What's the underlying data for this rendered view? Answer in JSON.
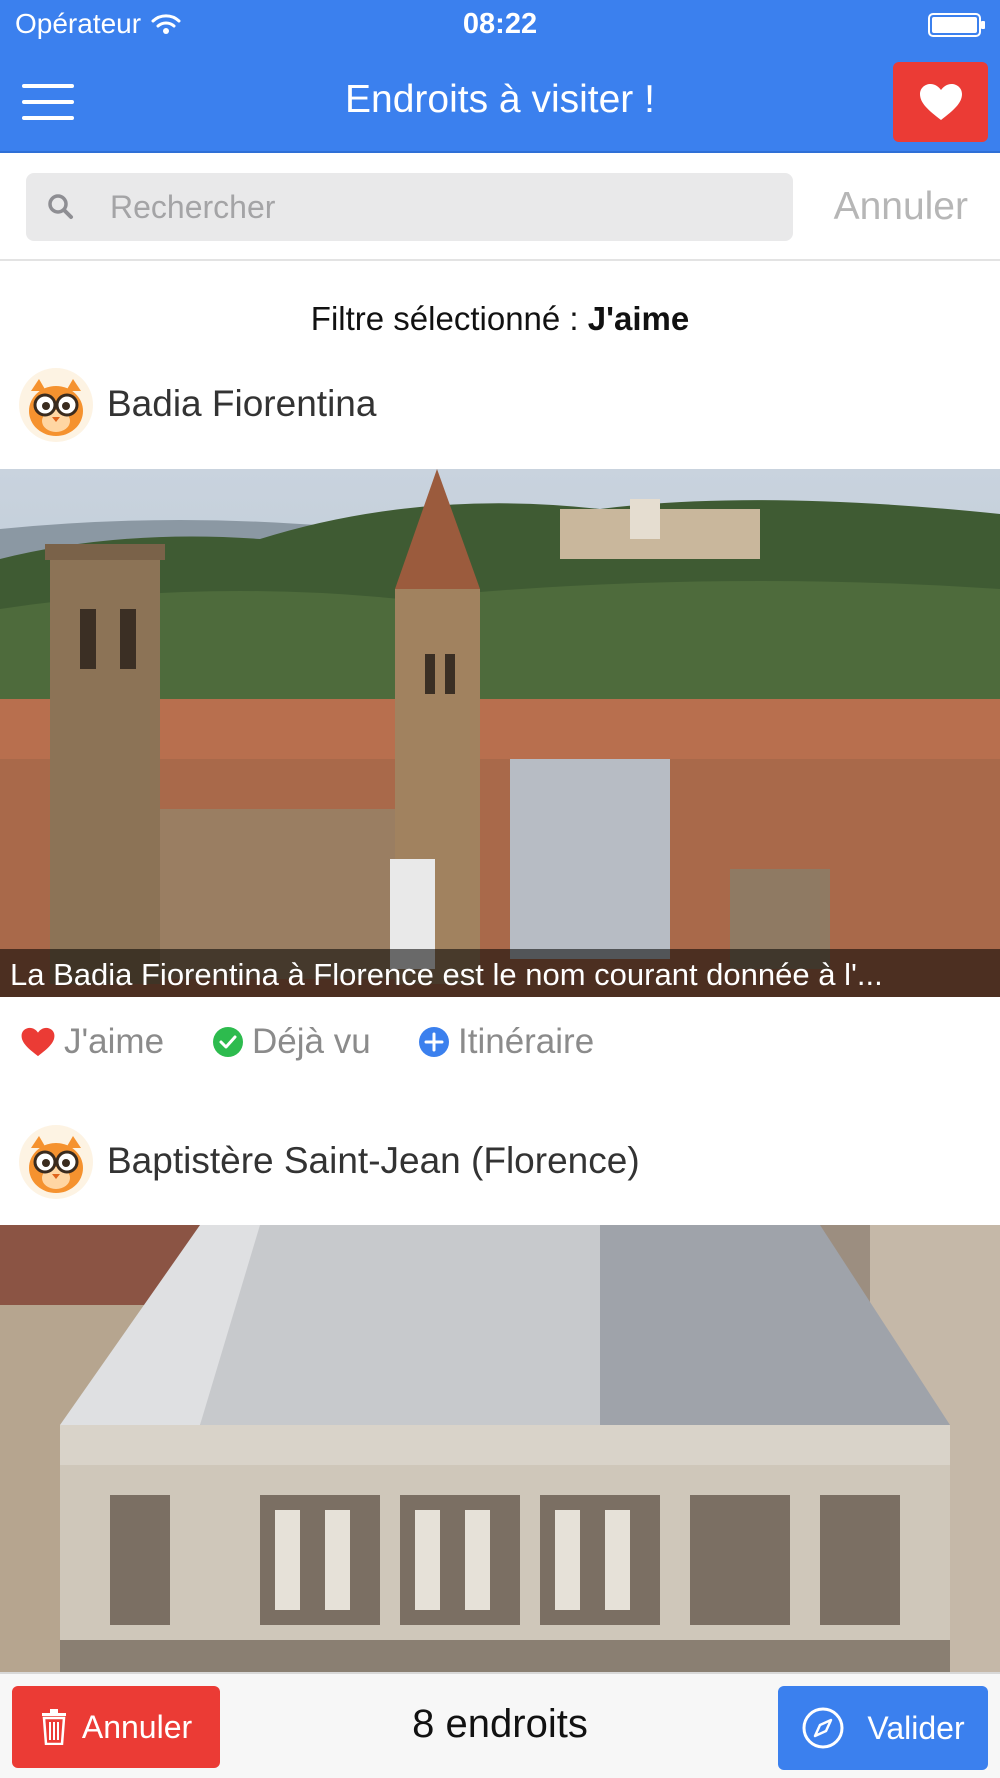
{
  "status_bar": {
    "carrier": "Opérateur",
    "time": "08:22"
  },
  "nav": {
    "title": "Endroits à visiter !"
  },
  "search": {
    "placeholder": "Rechercher",
    "value": "",
    "cancel_label": "Annuler"
  },
  "filter": {
    "prefix": "Filtre sélectionné :",
    "value": "J'aime"
  },
  "places": [
    {
      "title": "Badia Fiorentina",
      "caption": "La Badia Fiorentina à Florence est le nom courant donnée à l'..."
    },
    {
      "title": "Baptistère Saint-Jean (Florence)",
      "caption": ""
    }
  ],
  "actions": {
    "like_label": "J'aime",
    "seen_label": "Déjà vu",
    "itinerary_label": "Itinéraire"
  },
  "bottom_bar": {
    "cancel_label": "Annuler",
    "count_label": "8 endroits",
    "validate_label": "Valider"
  },
  "colors": {
    "header_blue": "#3b80ee",
    "like_red": "#eb3b35",
    "seen_green": "#2dbb4e",
    "itinerary_blue": "#3b80ee"
  },
  "icons": {
    "wifi": "wifi-icon",
    "battery": "battery-icon",
    "menu": "hamburger-menu-icon",
    "favorites": "heart-icon",
    "search": "search-icon",
    "avatar": "owl-mascot-icon",
    "like": "heart-icon",
    "seen": "check-circle-icon",
    "itinerary": "plus-circle-icon",
    "trash": "trash-icon",
    "compass": "compass-icon"
  }
}
